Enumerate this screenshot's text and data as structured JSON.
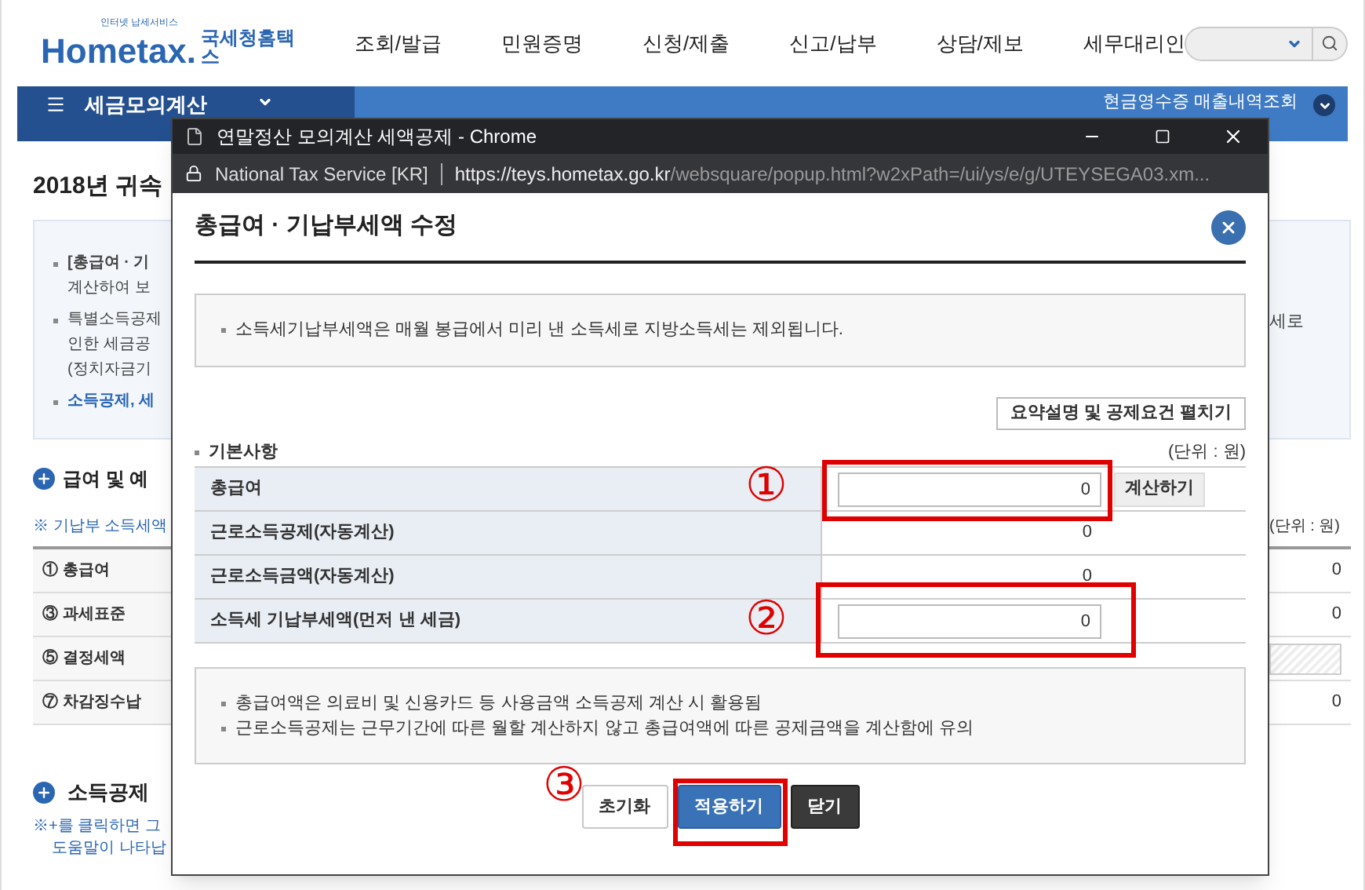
{
  "header": {
    "logo": {
      "tagline": "인터넷 납세서비스",
      "wordmark": "Hometax.",
      "name": "국세청홈택스"
    },
    "nav": [
      "조회/발급",
      "민원증명",
      "신청/제출",
      "신고/납부",
      "상담/제보",
      "세무대리인"
    ]
  },
  "menu_bar": {
    "title": "세금모의계산",
    "link": "현금영수증 매출내역조회"
  },
  "page": {
    "heading": "2018년 귀속",
    "info": [
      {
        "text": "[총급여 · 기",
        "kind": "bullet"
      },
      {
        "text": "계산하여 보",
        "kind": "continuation"
      },
      {
        "text": "특별소득공제",
        "kind": "bullet"
      },
      {
        "text": "인한 세금공",
        "kind": "continuation"
      },
      {
        "text": "(정치자금기",
        "kind": "continuation"
      },
      {
        "text": "소득공제, 세",
        "kind": "link"
      }
    ],
    "info_right": "세로",
    "salary": {
      "title": "급여 및 예",
      "note": "※ 기납부 소득세액",
      "unit": "(단위 : 원)",
      "rows": [
        {
          "label": "① 총급여",
          "kind": "value",
          "value": "0"
        },
        {
          "label": "③ 과세표준",
          "kind": "value",
          "value": "0"
        },
        {
          "label": "⑤ 결정세액",
          "kind": "hatched"
        },
        {
          "label": "⑦ 차감징수납",
          "kind": "value",
          "value": "0"
        }
      ]
    },
    "deduction": {
      "title": "소득공제",
      "notes": [
        "※+를 클릭하면 그",
        "도움말이 나타납"
      ]
    }
  },
  "popup": {
    "window": {
      "title": "연말정산 모의계산 세액공제 - Chrome"
    },
    "address": {
      "site": "National Tax Service [KR]",
      "host": "https://teys.hometax.go.kr",
      "path": "/websquare/popup.html?w2xPath=/ui/ys/e/g/UTEYSEGA03.xm..."
    },
    "dialog": {
      "title": "총급여 · 기납부세액 수정",
      "notice": "소득세기납부세액은 매월 봉급에서 미리 낸 소득세로 지방소득세는 제외됩니다.",
      "expand_button": "요약설명 및 공제요건 펼치기",
      "section": "기본사항",
      "unit": "(단위 : 원)",
      "rows": [
        {
          "label": "총급여",
          "kind": "input",
          "value": "0",
          "button": "계산하기"
        },
        {
          "label": "근로소득공제(자동계산)",
          "kind": "text",
          "value": "0"
        },
        {
          "label": "근로소득금액(자동계산)",
          "kind": "text",
          "value": "0"
        },
        {
          "label": "소득세 기납부세액(먼저 낸 세금)",
          "kind": "input",
          "value": "0"
        }
      ],
      "notes": [
        "총급여액은 의료비 및 신용카드 등 사용금액 소득공제 계산 시 활용됨",
        "근로소득공제는 근무기간에 따른 월할 계산하지 않고 총급여액에 따른 공제금액을 계산함에 유의"
      ],
      "buttons": [
        {
          "label": "초기화",
          "kind": "default"
        },
        {
          "label": "적용하기",
          "kind": "primary"
        },
        {
          "label": "닫기",
          "kind": "dark"
        }
      ]
    }
  },
  "annotations": [
    {
      "number": "①"
    },
    {
      "number": "②"
    },
    {
      "number": "③"
    }
  ]
}
